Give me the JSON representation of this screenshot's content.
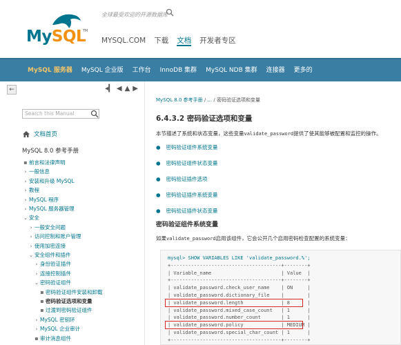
{
  "header": {
    "logo": {
      "my": "My",
      "sql": "SQL",
      "tm": "TM"
    },
    "search_placeholder": "全球最受欢迎的开源数据库",
    "topnav": [
      "MYSQL.COM",
      "下载",
      "文档",
      "开发者专区"
    ]
  },
  "bluenav": {
    "items": [
      "MySQL 服务器",
      "MySQL 企业版",
      "工作台",
      "InnoDB 集群",
      "MySQL NDB 集群",
      "连接器",
      "更多的"
    ]
  },
  "sidebar": {
    "search_placeholder": "Search this Manual",
    "home_label": "文档首页",
    "title": "MySQL 8.0 参考手册",
    "toc": [
      {
        "marker": "■",
        "label": "前言和法律声明",
        "indent": 0
      },
      {
        "marker": "›",
        "label": "一般信息",
        "indent": 0
      },
      {
        "marker": "›",
        "label": "安装和升级 MySQL",
        "indent": 0
      },
      {
        "marker": "›",
        "label": "教程",
        "indent": 0
      },
      {
        "marker": "›",
        "label": "MySQL 程序",
        "indent": 0
      },
      {
        "marker": "›",
        "label": "MySQL 服务器管理",
        "indent": 0
      },
      {
        "marker": "⌄",
        "label": "安全",
        "indent": 0
      },
      {
        "marker": "›",
        "label": "一般安全问题",
        "indent": 1
      },
      {
        "marker": "›",
        "label": "访问控制和账户管理",
        "indent": 1
      },
      {
        "marker": "›",
        "label": "使用加密连接",
        "indent": 1
      },
      {
        "marker": "⌄",
        "label": "安全组件和插件",
        "indent": 1
      },
      {
        "marker": "›",
        "label": "身份验证插件",
        "indent": 2
      },
      {
        "marker": "›",
        "label": "连接控制插件",
        "indent": 2
      },
      {
        "marker": "⌄",
        "label": "密码验证组件",
        "indent": 2
      },
      {
        "marker": "■",
        "label": "密码验证组件安装和卸载",
        "indent": 3
      },
      {
        "marker": "■",
        "label": "密码验证选项和变量",
        "indent": 3,
        "current": true
      },
      {
        "marker": "■",
        "label": "过渡到密码验证组件",
        "indent": 3
      },
      {
        "marker": "›",
        "label": "MySQL 密钥环",
        "indent": 2
      },
      {
        "marker": "›",
        "label": "MySQL 企业审计",
        "indent": 2
      },
      {
        "marker": "■",
        "label": "审计消息组件",
        "indent": 2
      }
    ]
  },
  "main": {
    "breadcrumb": {
      "root": "MySQL 8.0 参考手册",
      "sep1": "/",
      "ellipsis": "...",
      "sep2": "/",
      "current": "密码验证选项和变量"
    },
    "heading": "6.4.3.2 密码验证选项和变量",
    "intro_pre": "本节描述了系统和状态变量，这些变量",
    "intro_code": "validate_password",
    "intro_post": "提供了使其能够被配置和监控的操作。",
    "links": [
      "密码验证组件系统变量",
      "密码验证组件状态变量",
      "密码验证插件选项",
      "密码验证插件系统变量",
      "密码验证插件状态变量"
    ],
    "subheading": "密码验证组件系统变量",
    "para_pre": "如果",
    "para_code": "validate_password",
    "para_post": "启用该组件，它会公开几个启用密码检查配置的系统变量：",
    "code_lines": [
      "mysql> SHOW VARIABLES LIKE 'validate_password.%';",
      "+--------------------------------------+--------+",
      "| Variable_name                        | Value  |",
      "+--------------------------------------+--------+",
      "| validate_password.check_user_name    | ON     |",
      "| validate_password.dictionary_file    |        |",
      "| validate_password.length             | 8      |",
      "| validate_password.mixed_case_count   | 1      |",
      "| validate_password.number_count       | 1      |",
      "| validate_password.policy             | MEDIUM |",
      "| validate_password.special_char_count | 1      |",
      "+--------------------------------------+--------+"
    ]
  },
  "colors": {
    "accent": "#00758f",
    "nav_bg": "#3a7ea3",
    "highlight": "#d62828",
    "brand_orange": "#f29111"
  }
}
